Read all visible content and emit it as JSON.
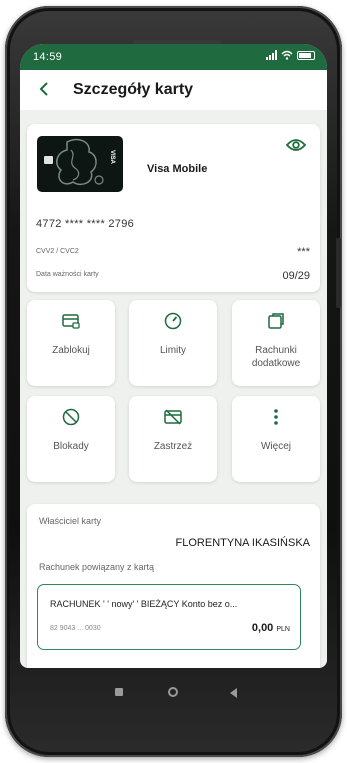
{
  "status": {
    "time": "14:59"
  },
  "header": {
    "back_icon": "chevron-left-icon",
    "title": "Szczegóły karty"
  },
  "card": {
    "name": "Visa Mobile",
    "brand_on_card": "VISA",
    "number": "4772 **** **** 2796",
    "cvv_label": "CVV2 / CVC2",
    "cvv_value": "***",
    "expiry_label": "Data ważności karty",
    "expiry_value": "09/29",
    "visibility_icon": "eye-icon"
  },
  "actions": [
    {
      "label": "Zablokuj",
      "icon": "card-lock-icon"
    },
    {
      "label": "Limity",
      "icon": "gauge-icon"
    },
    {
      "label": "Rachunki dodatkowe",
      "icon": "card-plus-icon"
    },
    {
      "label": "Blokady",
      "icon": "block-icon"
    },
    {
      "label": "Zastrzeż",
      "icon": "card-strike-icon"
    },
    {
      "label": "Więcej",
      "icon": "more-vertical-icon"
    }
  ],
  "owner": {
    "label": "Właściciel karty",
    "name": "FLORENTYNA IKASIŃSKA",
    "linked_label": "Rachunek powiązany z kartą"
  },
  "account": {
    "name": "RACHUNEK ' ' nowy' ' BIEŻĄCY Konto bez o...",
    "number": "82 9043 ... 0030",
    "amount": "0,00",
    "currency": "PLN"
  },
  "colors": {
    "brand": "#1f6a3e",
    "accent": "#2b8a57",
    "background": "#eef1ed"
  }
}
